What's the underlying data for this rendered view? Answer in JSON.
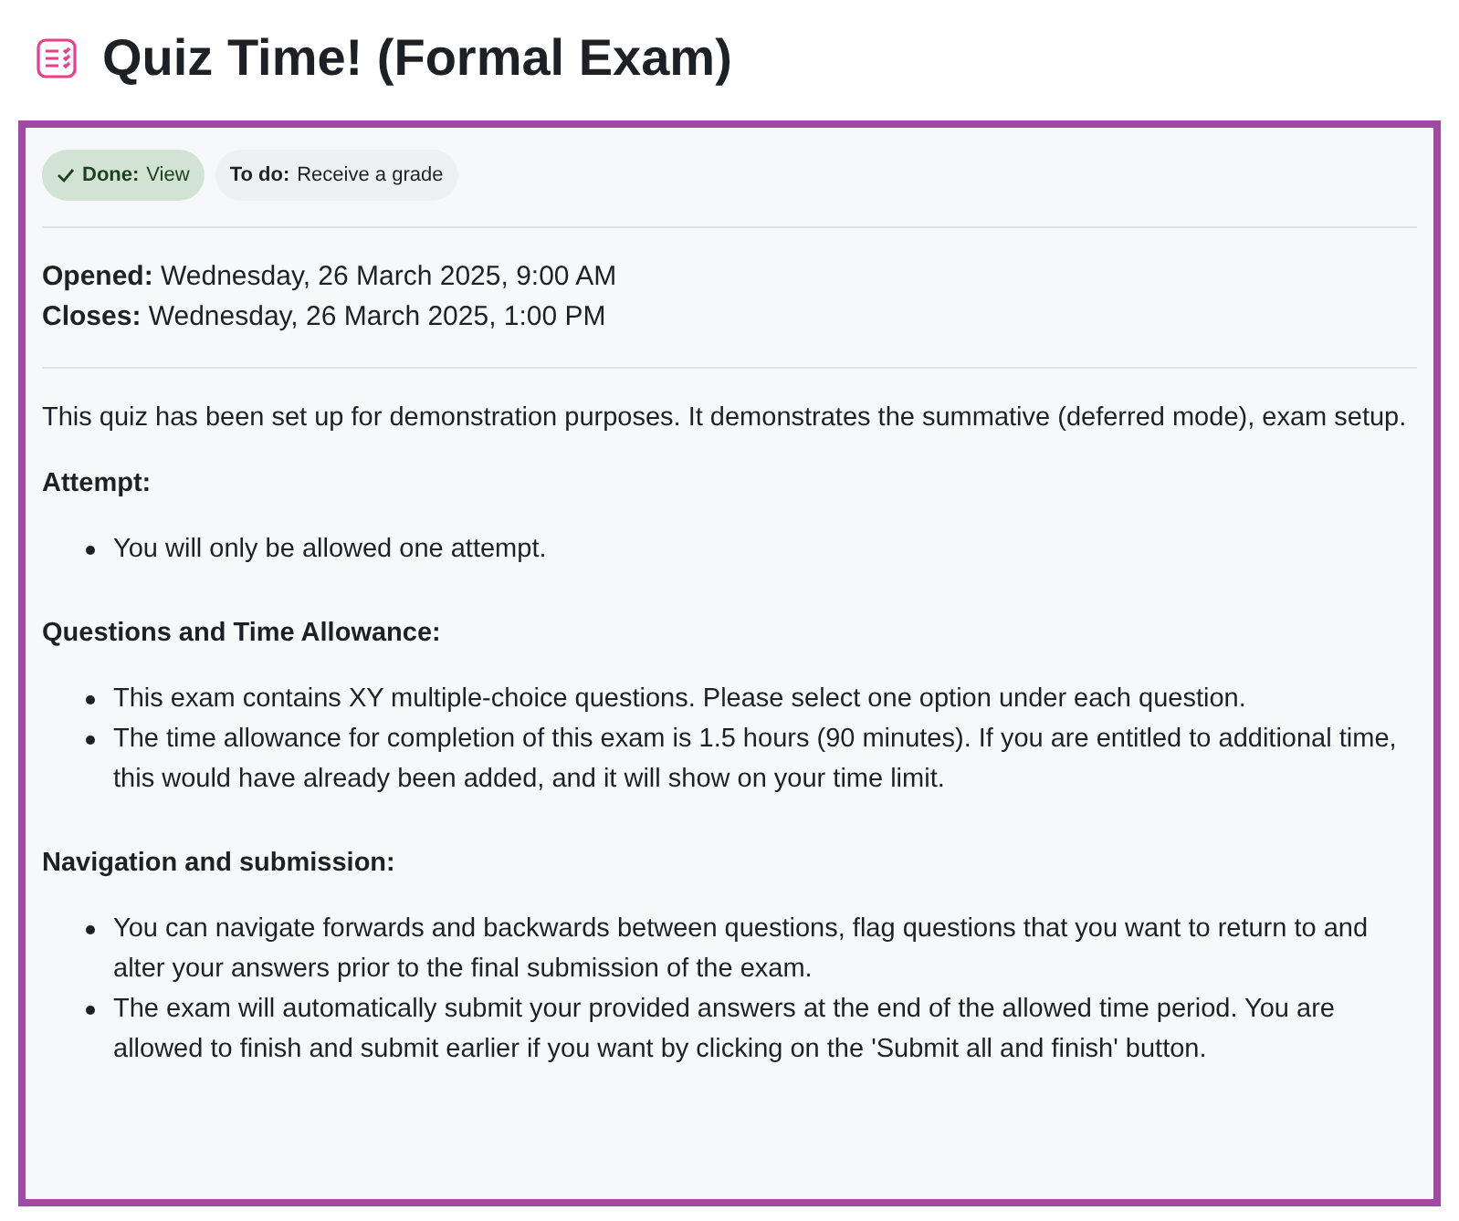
{
  "title": "Quiz Time! (Formal Exam)",
  "completion": [
    {
      "label": "Done:",
      "value": "View",
      "done": true
    },
    {
      "label": "To do:",
      "value": "Receive a grade",
      "done": false
    }
  ],
  "dates": [
    {
      "label": "Opened:",
      "value": "Wednesday, 26 March 2025, 9:00 AM"
    },
    {
      "label": "Closes:",
      "value": "Wednesday, 26 March 2025, 1:00 PM"
    }
  ],
  "intro": "This quiz has been set up for demonstration purposes. It demonstrates the summative (deferred mode), exam setup.",
  "sections": [
    {
      "heading": "Attempt:",
      "items": [
        "You will only be allowed one attempt."
      ]
    },
    {
      "heading": "Questions and Time Allowance:",
      "items": [
        "This exam contains XY multiple-choice questions. Please select one option under each question.",
        "The time allowance for completion of this exam is 1.5 hours (90 minutes). If you are entitled to additional time, this would have already been added, and it will show on your time limit."
      ]
    },
    {
      "heading": "Navigation and submission:",
      "items": [
        "You can navigate forwards and backwards between questions, flag questions that you want to return to and alter your answers prior to the final submission of the exam.",
        "The exam will automatically submit your provided answers at the end of the allowed time period. You are allowed to finish and submit earlier if you want by clicking on the 'Submit all and finish' button."
      ]
    }
  ]
}
